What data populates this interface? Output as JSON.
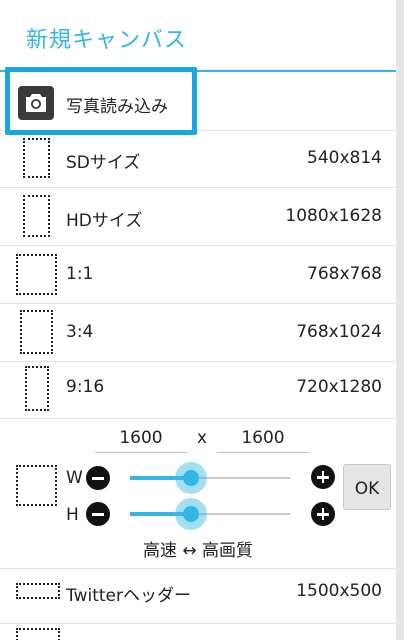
{
  "dialog": {
    "title": "新規キャンバス",
    "accent_color": "#33b5e5",
    "photo_import": {
      "label": "写真読み込み",
      "icon": "camera-icon"
    },
    "presets": [
      {
        "label": "SDサイズ",
        "size": "540x814"
      },
      {
        "label": "HDサイズ",
        "size": "1080x1628"
      },
      {
        "label": "1:1",
        "size": "768x768"
      },
      {
        "label": "3:4",
        "size": "768x1024"
      },
      {
        "label": "9:16",
        "size": "720x1280"
      }
    ],
    "custom": {
      "width_value": "1600",
      "times": "x",
      "height_value": "1600",
      "w_label": "W",
      "h_label": "H",
      "w_slider_percent": 38,
      "h_slider_percent": 38,
      "ok_label": "OK",
      "speed_quality_label": "高速 ↔ 高画質"
    },
    "extra_presets": [
      {
        "label": "Twitterヘッダー",
        "size": "1500x500"
      }
    ]
  }
}
